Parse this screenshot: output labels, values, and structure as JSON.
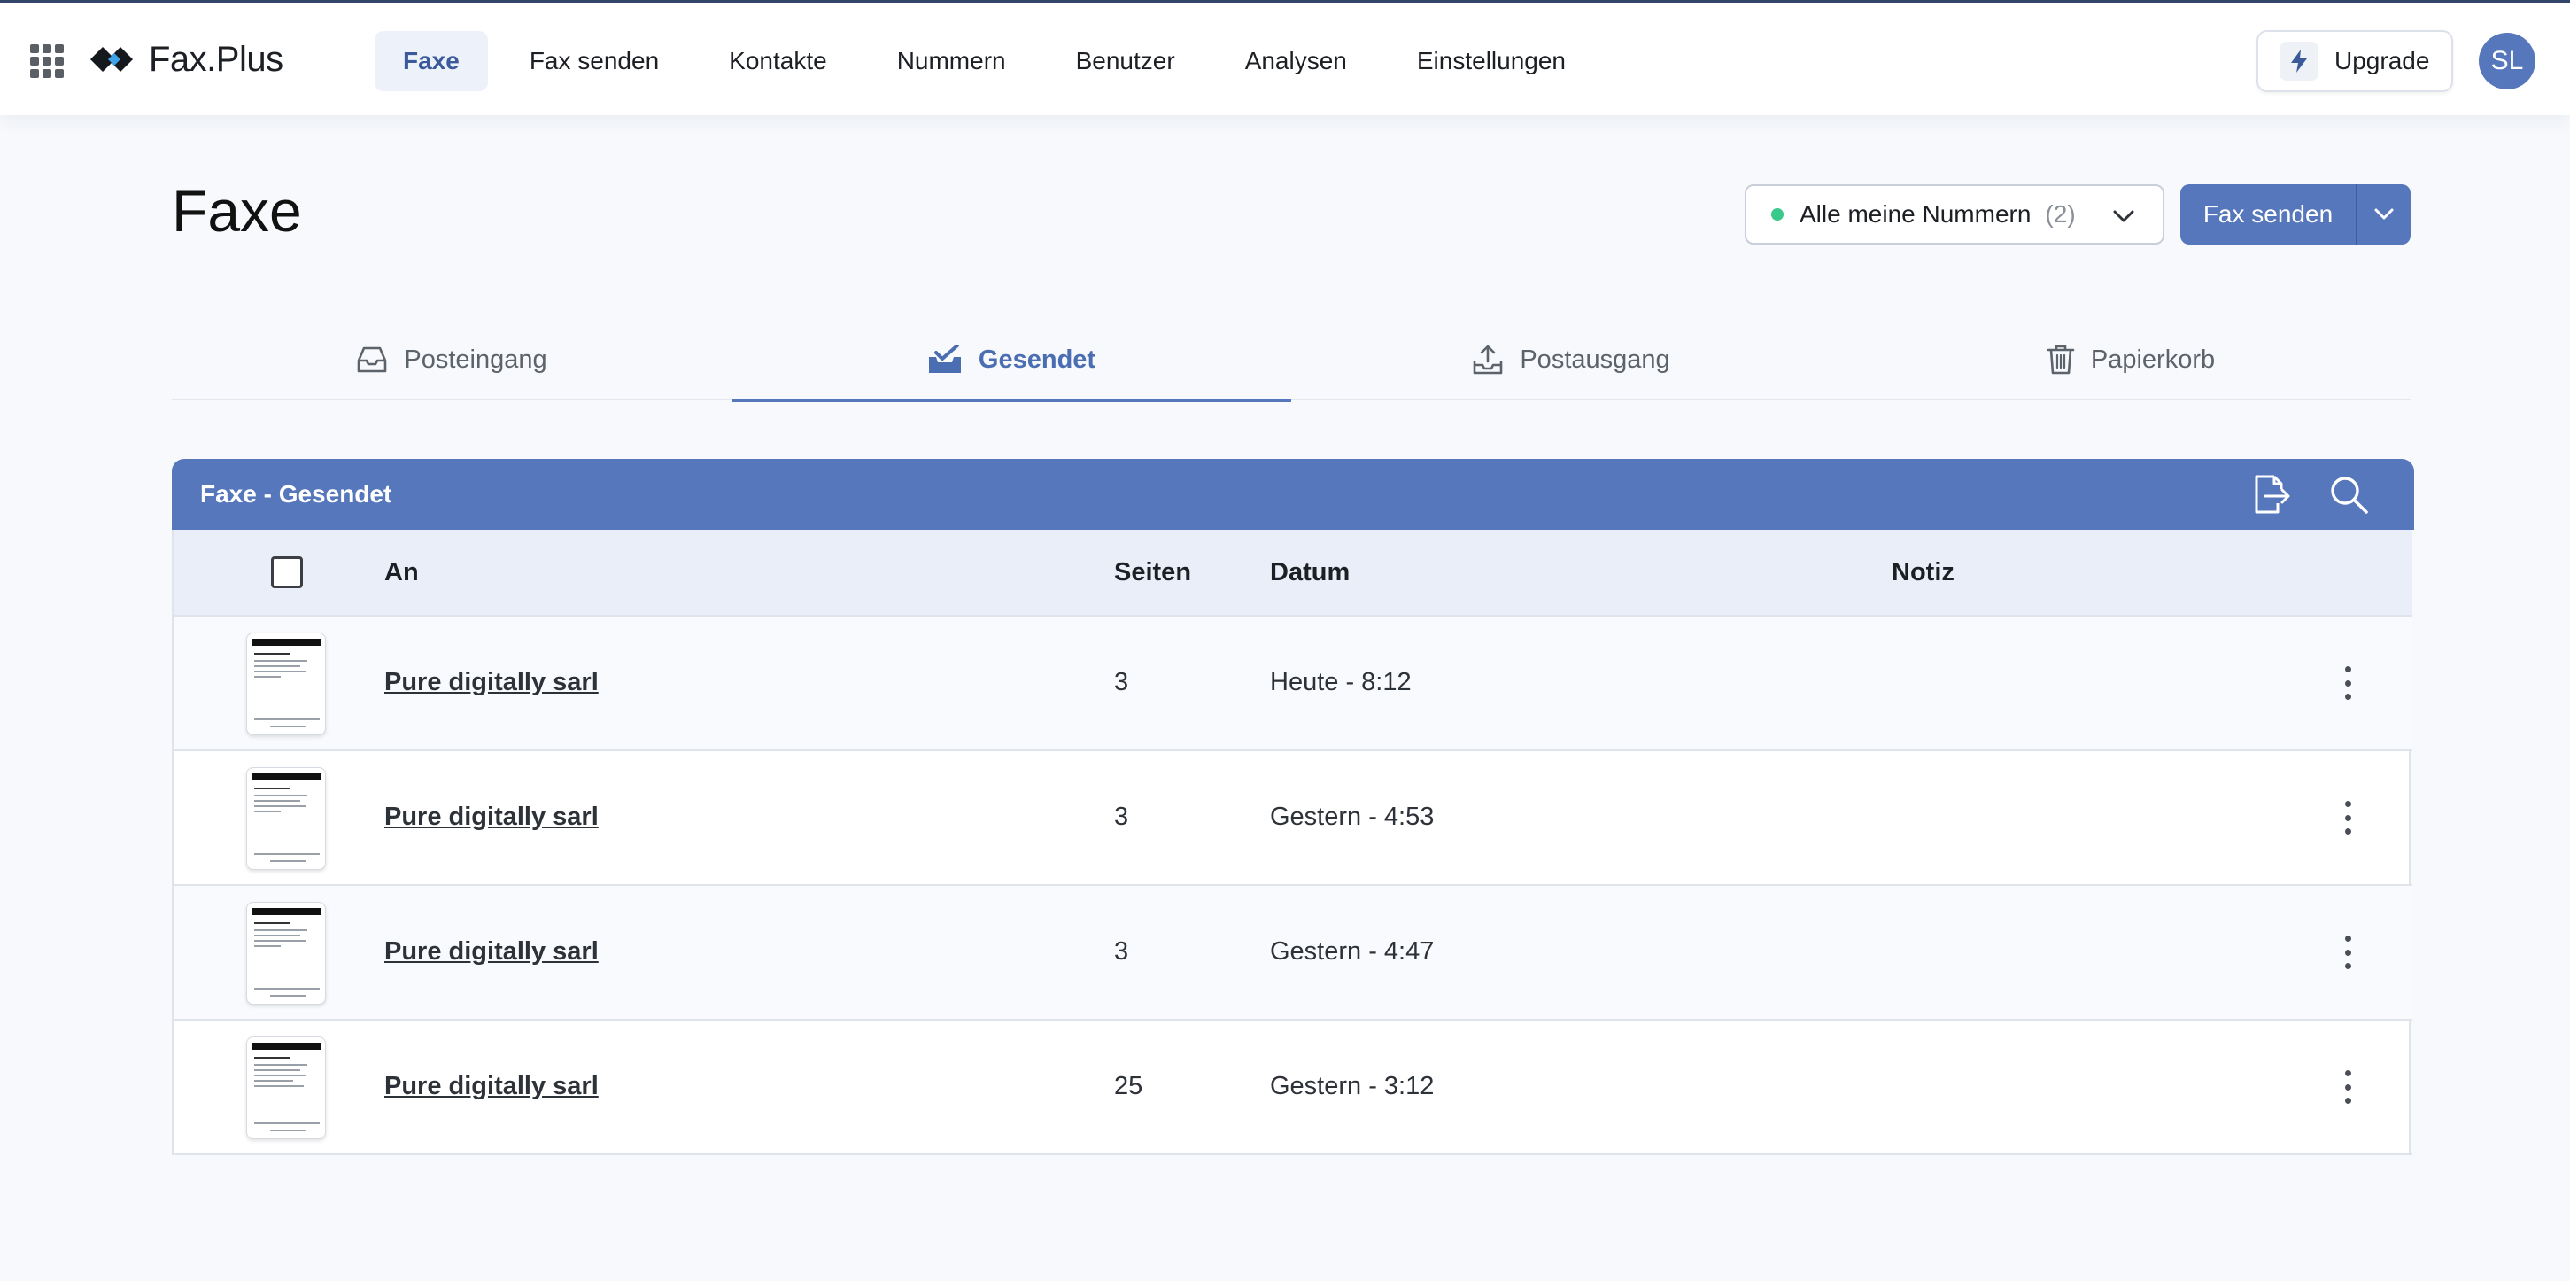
{
  "app": {
    "name": "Fax.Plus"
  },
  "nav": {
    "items": [
      {
        "label": "Faxe",
        "active": true
      },
      {
        "label": "Fax senden"
      },
      {
        "label": "Kontakte"
      },
      {
        "label": "Nummern"
      },
      {
        "label": "Benutzer"
      },
      {
        "label": "Analysen"
      },
      {
        "label": "Einstellungen"
      }
    ],
    "upgrade_label": "Upgrade",
    "avatar_initials": "SL"
  },
  "page": {
    "title": "Faxe",
    "number_select": {
      "label": "Alle meine Nummern",
      "count": "(2)"
    },
    "send_button": "Fax senden"
  },
  "tabs": [
    {
      "label": "Posteingang",
      "icon": "inbox-icon"
    },
    {
      "label": "Gesendet",
      "icon": "sent-check-icon",
      "active": true
    },
    {
      "label": "Postausgang",
      "icon": "outbox-upload-icon"
    },
    {
      "label": "Papierkorb",
      "icon": "trash-icon"
    }
  ],
  "table": {
    "title": "Faxe - Gesendet",
    "columns": {
      "to": "An",
      "pages": "Seiten",
      "date": "Datum",
      "note": "Notiz"
    },
    "rows": [
      {
        "to": "Pure digitally sarl",
        "pages": "3",
        "date": "Heute - 8:12",
        "note": ""
      },
      {
        "to": "Pure digitally sarl",
        "pages": "3",
        "date": "Gestern - 4:53",
        "note": ""
      },
      {
        "to": "Pure digitally sarl",
        "pages": "3",
        "date": "Gestern - 4:47",
        "note": ""
      },
      {
        "to": "Pure digitally sarl",
        "pages": "25",
        "date": "Gestern - 3:12",
        "note": ""
      }
    ]
  },
  "colors": {
    "accent": "#5677bb",
    "nav_active_bg": "#edf2fa",
    "status_green": "#39c98a",
    "header_row_bg": "#e9eef8"
  }
}
